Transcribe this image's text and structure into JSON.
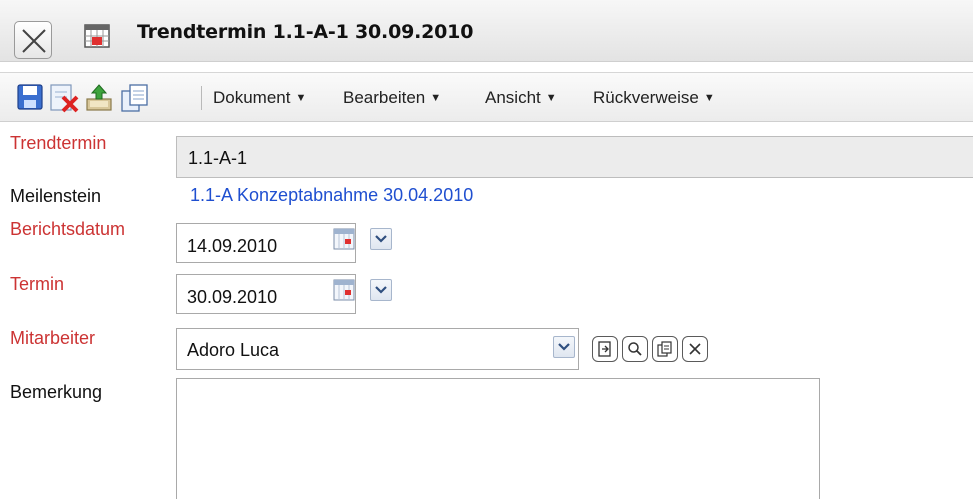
{
  "window": {
    "title": "Trendtermin 1.1-A-1 30.09.2010",
    "close_icon": "close-icon",
    "title_icon": "calendar-icon"
  },
  "toolbar": {
    "icons": [
      "save-icon",
      "delete-icon",
      "upload-icon",
      "copy-icon"
    ],
    "menus": [
      {
        "label": "Dokument"
      },
      {
        "label": "Bearbeiten"
      },
      {
        "label": "Ansicht"
      },
      {
        "label": "Rückverweise"
      }
    ]
  },
  "form": {
    "trendtermin": {
      "label": "Trendtermin",
      "value": "1.1-A-1"
    },
    "meilenstein": {
      "label": "Meilenstein",
      "value": "1.1-A Konzeptabnahme 30.04.2010"
    },
    "berichtsdatum": {
      "label": "Berichtsdatum",
      "value": "14.09.2010"
    },
    "termin": {
      "label": "Termin",
      "value": "30.09.2010"
    },
    "mitarbeiter": {
      "label": "Mitarbeiter",
      "value": "Adoro Luca",
      "action_icons": [
        "open-icon",
        "search-icon",
        "copy-icon",
        "clear-icon"
      ]
    },
    "bemerkung": {
      "label": "Bemerkung",
      "value": ""
    }
  },
  "colors": {
    "required_label": "#cc3333",
    "link": "#1f4fd0"
  }
}
